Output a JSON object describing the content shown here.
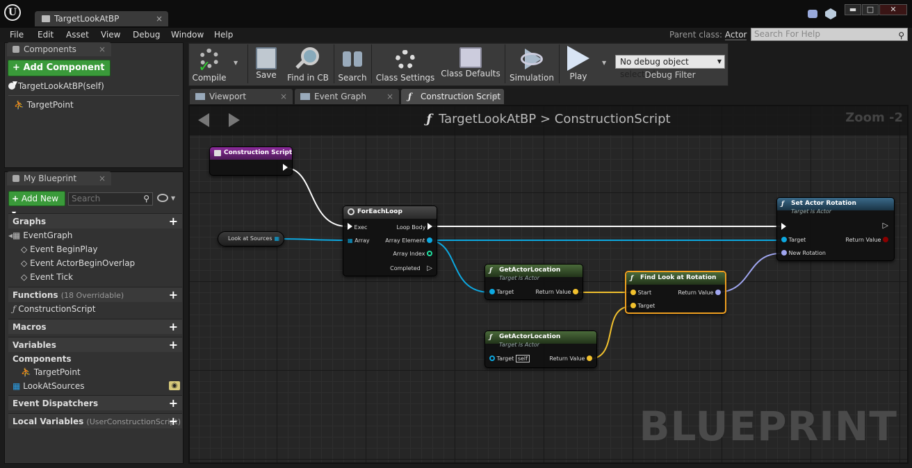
{
  "window": {
    "doc_tab": "TargetLookAtBP",
    "tab_close": "×",
    "minimize": "▬",
    "maximize": "□",
    "close": "✕"
  },
  "menu": [
    "File",
    "Edit",
    "Asset",
    "View",
    "Debug",
    "Window",
    "Help"
  ],
  "parent_class": {
    "label": "Parent class:",
    "value": "Actor"
  },
  "help_search": {
    "placeholder": "Search For Help"
  },
  "components": {
    "tab": "Components",
    "add_button": "Add Component",
    "root": "TargetLookAtBP(self)",
    "items": [
      "TargetPoint"
    ]
  },
  "my_blueprint": {
    "tab": "My Blueprint",
    "add_new": "Add New",
    "search_placeholder": "Search",
    "sections": {
      "graphs": {
        "title": "Graphs",
        "items": [
          "EventGraph",
          "Event BeginPlay",
          "Event ActorBeginOverlap",
          "Event Tick"
        ]
      },
      "functions": {
        "title": "Functions",
        "sub": "(18 Overridable)",
        "items": [
          "ConstructionScript"
        ]
      },
      "macros": {
        "title": "Macros"
      },
      "variables": {
        "title": "Variables",
        "group": "Components",
        "items": [
          "TargetPoint",
          "LookAtSources"
        ]
      },
      "dispatchers": {
        "title": "Event Dispatchers"
      },
      "locals": {
        "title": "Local Variables",
        "sub": "(UserConstructionScript)"
      }
    }
  },
  "toolbar": {
    "compile": "Compile",
    "save": "Save",
    "find": "Find in CB",
    "search": "Search",
    "class_settings": "Class Settings",
    "class_defaults": "Class Defaults",
    "simulation": "Simulation",
    "play": "Play",
    "debug_select": "No debug object selected",
    "debug_filter": "Debug Filter"
  },
  "graph_tabs": [
    "Viewport",
    "Event Graph",
    "Construction Script"
  ],
  "graph": {
    "breadcrumb_bp": "TargetLookAtBP",
    "breadcrumb_sep": ">",
    "breadcrumb_fn": "ConstructionScript",
    "zoom": "Zoom -2",
    "watermark": "BLUEPRINT",
    "nodes": {
      "construction": {
        "title": "Construction Script"
      },
      "look_at_sources": {
        "title": "Look at Sources"
      },
      "foreach": {
        "title": "ForEachLoop",
        "exec": "Exec",
        "array": "Array",
        "loop_body": "Loop Body",
        "array_element": "Array Element",
        "array_index": "Array Index",
        "completed": "Completed"
      },
      "get_loc1": {
        "title": "GetActorLocation",
        "sub": "Target is Actor",
        "target": "Target",
        "ret": "Return Value"
      },
      "get_loc2": {
        "title": "GetActorLocation",
        "sub": "Target is Actor",
        "target": "Target",
        "self": "self",
        "ret": "Return Value"
      },
      "find_look": {
        "title": "Find Look at Rotation",
        "start": "Start",
        "target": "Target",
        "ret": "Return Value"
      },
      "set_rot": {
        "title": "Set Actor Rotation",
        "sub": "Target is Actor",
        "target": "Target",
        "new_rot": "New Rotation",
        "ret": "Return Value"
      }
    }
  },
  "colors": {
    "exec": "#ffffff",
    "object": "#0da8e0",
    "vector": "#f2c12e",
    "rotator": "#a0a6f0",
    "bool": "#8b0000",
    "int": "#1fe0a0"
  }
}
